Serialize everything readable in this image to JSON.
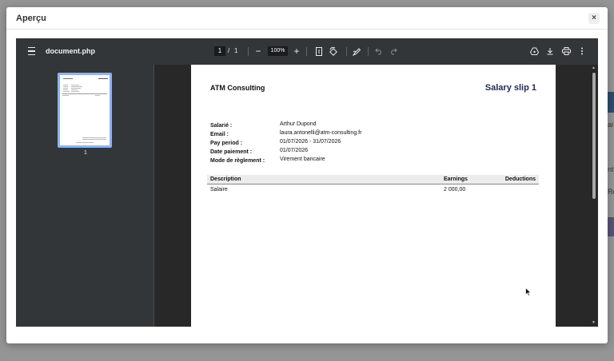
{
  "dialog": {
    "title": "Aperçu",
    "close_label": "×"
  },
  "background": {
    "fragments": [
      "ai",
      "nt",
      "Re"
    ]
  },
  "viewer": {
    "document_name": "document.php",
    "current_page": "1",
    "page_separator": "/",
    "total_pages": "1",
    "zoom": "100%",
    "zoom_out_label": "−",
    "zoom_in_label": "+",
    "thumbnail_number": "1",
    "icons": [
      "menu-icon",
      "fit-page-icon",
      "rotate-icon",
      "annotate-icon",
      "undo-icon",
      "redo-icon",
      "drive-icon",
      "download-icon",
      "print-icon",
      "more-options-icon"
    ]
  },
  "document": {
    "company": "ATM Consulting",
    "title": "Salary slip 1",
    "info": [
      {
        "label": "Salarié :",
        "value": "Arthur Dupond"
      },
      {
        "label": "Email :",
        "value": "laura.antonelli@atm-consulting.fr"
      },
      {
        "label": "Pay period :",
        "value": "01/07/2026 - 31/07/2026"
      },
      {
        "label": "Date paiement :",
        "value": "01/07/2026"
      },
      {
        "label": "Mode de règlement :",
        "value": "Virement bancaire"
      }
    ],
    "table": {
      "headers": [
        "Description",
        "Earnings",
        "Deductions"
      ],
      "rows": [
        {
          "description": "Salaire",
          "earnings": "2 000,00",
          "deductions": ""
        }
      ]
    }
  }
}
